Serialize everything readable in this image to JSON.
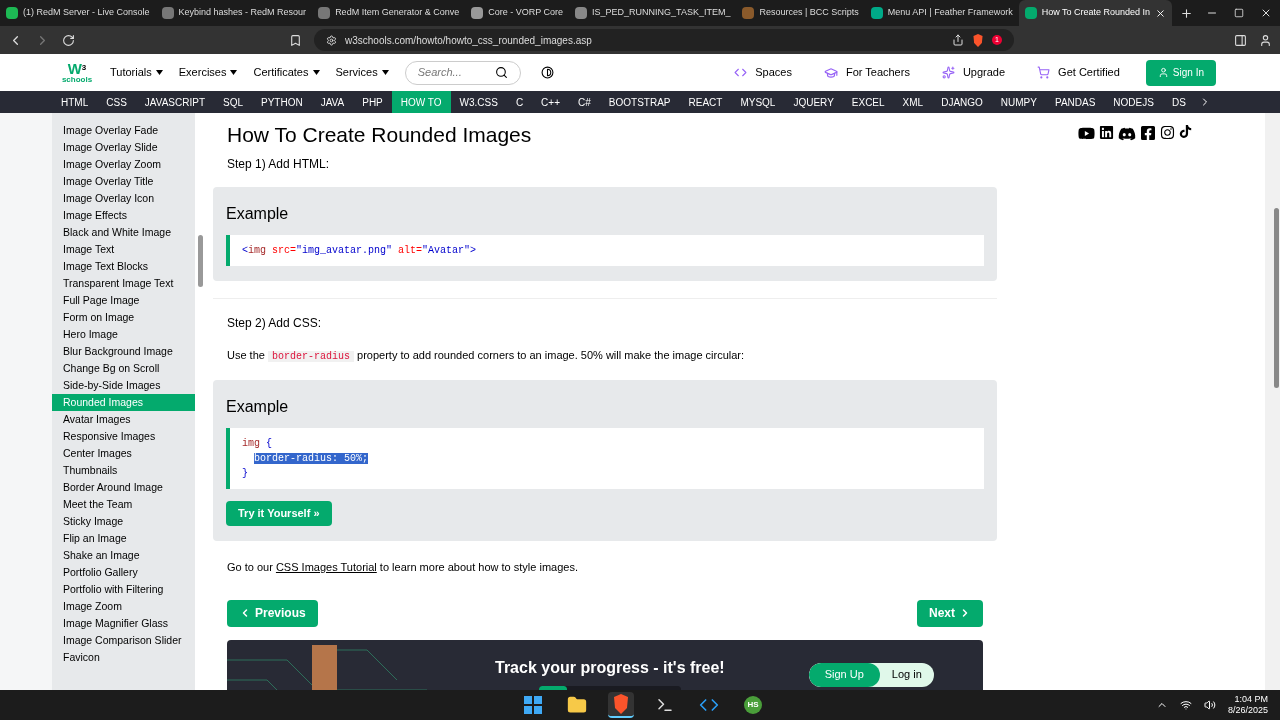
{
  "browser": {
    "tabs": [
      {
        "title": "(1) RedM Server - Live Console",
        "selected": false
      },
      {
        "title": "Keybind hashes - RedM Resour",
        "selected": false
      },
      {
        "title": "RedM Item Generator & Conve",
        "selected": false
      },
      {
        "title": "Core - VORP Core",
        "selected": false
      },
      {
        "title": "IS_PED_RUNNING_TASK_ITEM_",
        "selected": false
      },
      {
        "title": "Resources | BCC Scripts",
        "selected": false
      },
      {
        "title": "Menu API | Feather Framework",
        "selected": false
      },
      {
        "title": "How To Create Rounded In",
        "selected": true
      }
    ],
    "url": "w3schools.com/howto/howto_css_rounded_images.asp",
    "shield_badge": "1"
  },
  "header": {
    "logo": {
      "mark": "W",
      "sup": "3",
      "sub": "schools"
    },
    "menus": [
      "Tutorials",
      "Exercises",
      "Certificates",
      "Services"
    ],
    "search": {
      "placeholder": "Search..."
    },
    "links": [
      {
        "label": "Spaces",
        "kind": "spaces"
      },
      {
        "label": "For Teachers",
        "kind": "teachers"
      },
      {
        "label": "Upgrade",
        "kind": "upgrade"
      },
      {
        "label": "Get Certified",
        "kind": "cert"
      }
    ],
    "sign_in": "Sign In"
  },
  "topnav": [
    {
      "label": "HTML",
      "selected": false
    },
    {
      "label": "CSS",
      "selected": false
    },
    {
      "label": "JAVASCRIPT",
      "selected": false
    },
    {
      "label": "SQL",
      "selected": false
    },
    {
      "label": "PYTHON",
      "selected": false
    },
    {
      "label": "JAVA",
      "selected": false
    },
    {
      "label": "PHP",
      "selected": false
    },
    {
      "label": "HOW TO",
      "selected": true
    },
    {
      "label": "W3.CSS",
      "selected": false
    },
    {
      "label": "C",
      "selected": false
    },
    {
      "label": "C++",
      "selected": false
    },
    {
      "label": "C#",
      "selected": false
    },
    {
      "label": "BOOTSTRAP",
      "selected": false
    },
    {
      "label": "REACT",
      "selected": false
    },
    {
      "label": "MYSQL",
      "selected": false
    },
    {
      "label": "JQUERY",
      "selected": false
    },
    {
      "label": "EXCEL",
      "selected": false
    },
    {
      "label": "XML",
      "selected": false
    },
    {
      "label": "DJANGO",
      "selected": false
    },
    {
      "label": "NUMPY",
      "selected": false
    },
    {
      "label": "PANDAS",
      "selected": false
    },
    {
      "label": "NODEJS",
      "selected": false
    },
    {
      "label": "DS",
      "selected": false
    }
  ],
  "sidebar": {
    "items": [
      {
        "label": "Image Overlay Fade",
        "selected": false
      },
      {
        "label": "Image Overlay Slide",
        "selected": false
      },
      {
        "label": "Image Overlay Zoom",
        "selected": false
      },
      {
        "label": "Image Overlay Title",
        "selected": false
      },
      {
        "label": "Image Overlay Icon",
        "selected": false
      },
      {
        "label": "Image Effects",
        "selected": false
      },
      {
        "label": "Black and White Image",
        "selected": false
      },
      {
        "label": "Image Text",
        "selected": false
      },
      {
        "label": "Image Text Blocks",
        "selected": false
      },
      {
        "label": "Transparent Image Text",
        "selected": false
      },
      {
        "label": "Full Page Image",
        "selected": false
      },
      {
        "label": "Form on Image",
        "selected": false
      },
      {
        "label": "Hero Image",
        "selected": false
      },
      {
        "label": "Blur Background Image",
        "selected": false
      },
      {
        "label": "Change Bg on Scroll",
        "selected": false
      },
      {
        "label": "Side-by-Side Images",
        "selected": false
      },
      {
        "label": "Rounded Images",
        "selected": true
      },
      {
        "label": "Avatar Images",
        "selected": false
      },
      {
        "label": "Responsive Images",
        "selected": false
      },
      {
        "label": "Center Images",
        "selected": false
      },
      {
        "label": "Thumbnails",
        "selected": false
      },
      {
        "label": "Border Around Image",
        "selected": false
      },
      {
        "label": "Meet the Team",
        "selected": false
      },
      {
        "label": "Sticky Image",
        "selected": false
      },
      {
        "label": "Flip an Image",
        "selected": false
      },
      {
        "label": "Shake an Image",
        "selected": false
      },
      {
        "label": "Portfolio Gallery",
        "selected": false
      },
      {
        "label": "Portfolio with Filtering",
        "selected": false
      },
      {
        "label": "Image Zoom",
        "selected": false
      },
      {
        "label": "Image Magnifier Glass",
        "selected": false
      },
      {
        "label": "Image Comparison Slider",
        "selected": false
      },
      {
        "label": "Favicon",
        "selected": false
      }
    ]
  },
  "main": {
    "title": "How To Create Rounded Images",
    "step1": "Step 1) Add HTML:",
    "example1": {
      "heading": "Example",
      "lines": [
        [
          {
            "text": "<",
            "kind": "bracket",
            "selected": false
          },
          {
            "text": "img",
            "kind": "tag",
            "selected": false
          },
          {
            "text": " src=",
            "kind": "attr",
            "selected": false
          },
          {
            "text": "\"img_avatar.png\"",
            "kind": "value",
            "selected": false
          },
          {
            "text": " alt=",
            "kind": "attr",
            "selected": false
          },
          {
            "text": "\"Avatar\"",
            "kind": "value",
            "selected": false
          },
          {
            "text": ">",
            "kind": "bracket",
            "selected": false
          }
        ]
      ]
    },
    "step2": "Step 2) Add CSS:",
    "paragraph": [
      {
        "text": "Use the ",
        "kind": "text"
      },
      {
        "text": "border-radius",
        "kind": "code"
      },
      {
        "text": " property to add rounded corners to an image. 50% will make the image circular:",
        "kind": "text"
      }
    ],
    "example2": {
      "heading": "Example",
      "lines": [
        [
          {
            "text": "img",
            "kind": "tag",
            "selected": false
          },
          {
            "text": " {",
            "kind": "bracket",
            "selected": false
          }
        ],
        [
          {
            "text": "border-radius: 50%;",
            "kind": "property",
            "selected": true
          }
        ],
        [
          {
            "text": "}",
            "kind": "bracket",
            "selected": false
          }
        ]
      ],
      "button": "Try it Yourself »"
    },
    "footer_text": [
      {
        "text": "Go to our ",
        "kind": "text"
      },
      {
        "text": "CSS Images Tutorial",
        "kind": "link"
      },
      {
        "text": " to learn more about how to style images.",
        "kind": "text"
      }
    ],
    "previous": "Previous",
    "next": "Next",
    "banner": {
      "title": "Track your progress - it's free!",
      "level": 0.2,
      "sign_up": "Sign Up",
      "log_in": "Log in"
    }
  },
  "taskbar": {
    "apps": [
      {
        "kind": "start",
        "selected": false
      },
      {
        "kind": "folder",
        "selected": false
      },
      {
        "kind": "browser",
        "selected": true
      },
      {
        "kind": "terminal",
        "selected": false
      },
      {
        "kind": "editor",
        "selected": false
      },
      {
        "kind": "hs",
        "selected": false
      }
    ],
    "hs_label": "HS",
    "time": "1:04 PM",
    "date": "8/26/2025"
  }
}
